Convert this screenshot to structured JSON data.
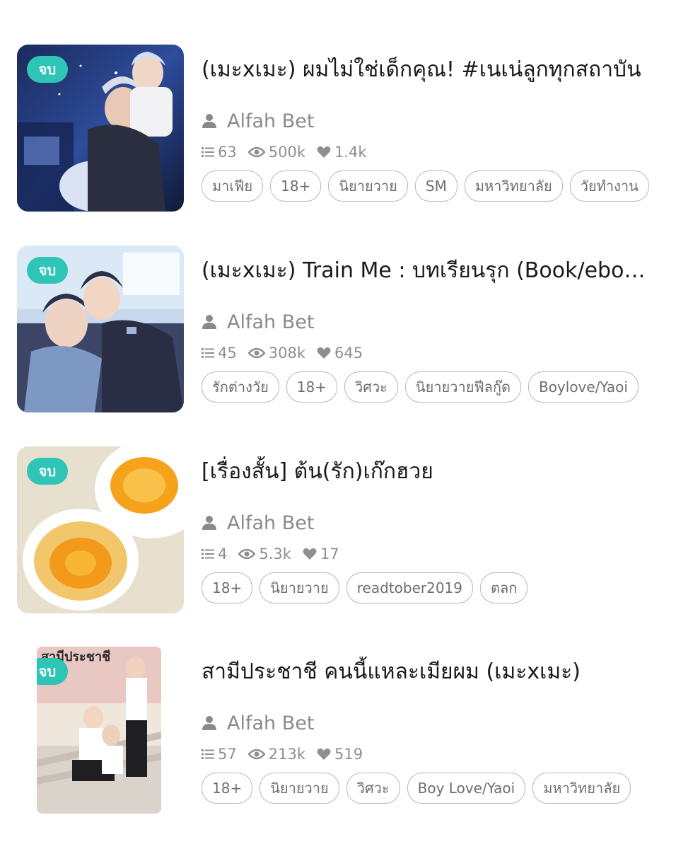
{
  "novels": [
    {
      "badge": "จบ",
      "title": "(เมะxเมะ) ผมไม่ใช่เด็กคุณ! #เนเน่ลูกทุกสถาบัน",
      "author": "Alfah Bet",
      "chapters": "63",
      "views": "500k",
      "likes": "1.4k",
      "tags": [
        "มาเฟีย",
        "18+",
        "นิยายวาย",
        "SM",
        "มหาวิทยาลัย",
        "วัยทำงาน"
      ]
    },
    {
      "badge": "จบ",
      "title": "(เมะxเมะ) Train Me : บทเรียนรุก (Book/ebook)",
      "author": "Alfah Bet",
      "chapters": "45",
      "views": "308k",
      "likes": "645",
      "tags": [
        "รักต่างวัย",
        "18+",
        "วิศวะ",
        "นิยายวายฟีลกู๊ด",
        "Boylove/Yaoi"
      ]
    },
    {
      "badge": "จบ",
      "title": "[เรื่องสั้น] ต้น(รัก)เก๊กฮวย",
      "author": "Alfah Bet",
      "chapters": "4",
      "views": "5.3k",
      "likes": "17",
      "tags": [
        "18+",
        "นิยายวาย",
        "readtober2019",
        "ตลก"
      ]
    },
    {
      "badge": "จบ",
      "title": "สามีประชาชี คนนี้แหละเมียผม (เมะxเมะ)",
      "author": "Alfah Bet",
      "chapters": "57",
      "views": "213k",
      "likes": "519",
      "tags": [
        "18+",
        "นิยายวาย",
        "วิศวะ",
        "Boy Love/Yaoi",
        "มหาวิทยาลัย"
      ]
    }
  ],
  "colors": {
    "badge": "#2ec4b6",
    "meta": "#8a8a8a",
    "tag_border": "#b8b8b8"
  },
  "icons": {
    "author": "person-icon",
    "chapters": "list-icon",
    "views": "eye-icon",
    "likes": "heart-icon"
  }
}
